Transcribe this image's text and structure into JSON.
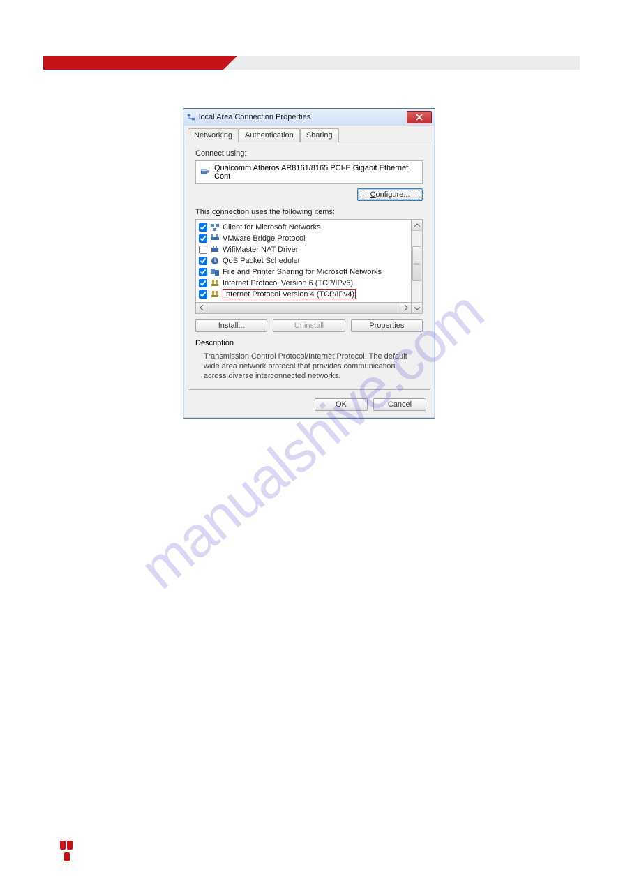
{
  "watermark": "manualshive.com",
  "dialog": {
    "title": "local Area Connection Properties",
    "tabs": [
      "Networking",
      "Authentication",
      "Sharing"
    ],
    "connect_label": "Connect using:",
    "adapter": "Qualcomm Atheros AR8161/8165 PCI-E Gigabit Ethernet Cont",
    "configure": "Configure...",
    "items_label": "This connection uses the following items:",
    "items": [
      {
        "checked": true,
        "icon": "clients",
        "label": "Client for Microsoft Networks"
      },
      {
        "checked": true,
        "icon": "bridge",
        "label": "VMware Bridge Protocol"
      },
      {
        "checked": false,
        "icon": "driver",
        "label": "WifiMaster NAT Driver"
      },
      {
        "checked": true,
        "icon": "scheduler",
        "label": "QoS Packet Scheduler"
      },
      {
        "checked": true,
        "icon": "share",
        "label": "File and Printer Sharing for Microsoft Networks"
      },
      {
        "checked": true,
        "icon": "protocol",
        "label": "Internet Protocol Version 6 (TCP/IPv6)"
      },
      {
        "checked": true,
        "icon": "protocol",
        "label": "Internet Protocol Version 4 (TCP/IPv4)",
        "highlight": true
      }
    ],
    "install": "Install...",
    "uninstall": "Uninstall",
    "properties": "Properties",
    "desc_title": "Description",
    "desc_text": "Transmission Control Protocol/Internet Protocol. The default wide area network protocol that provides communication across diverse interconnected networks.",
    "ok": "OK",
    "cancel": "Cancel"
  }
}
